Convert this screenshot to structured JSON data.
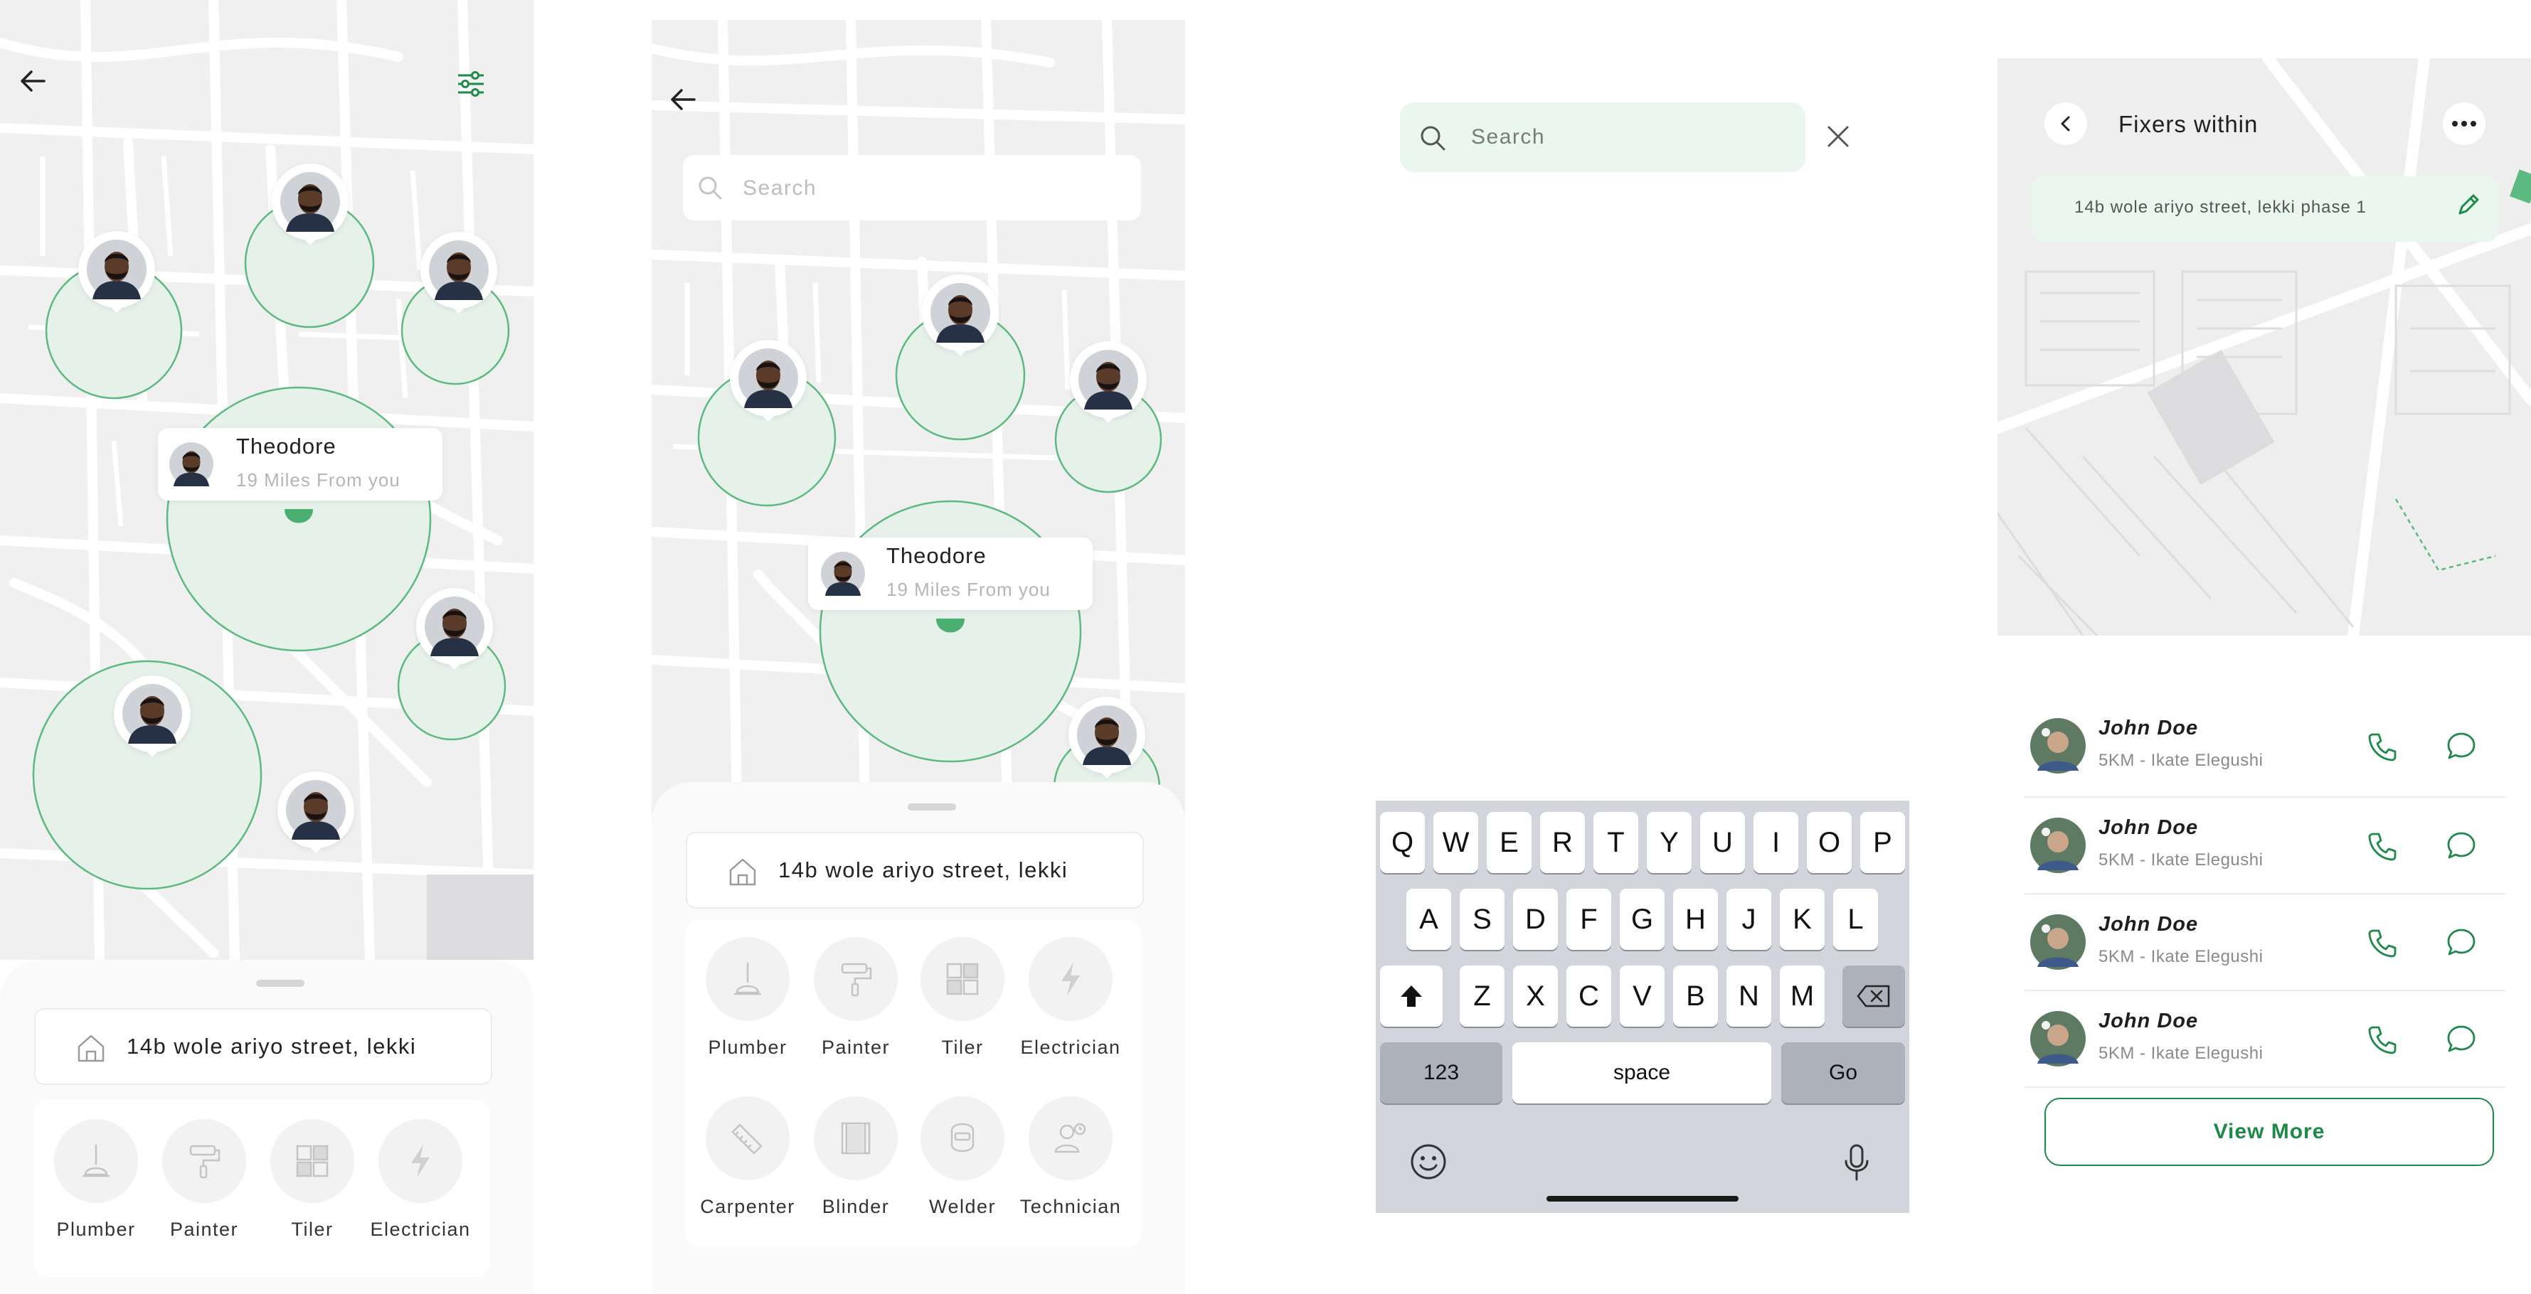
{
  "colors": {
    "accent": "#1e8a4a",
    "circle_fill": "#e6f1ea",
    "circle_stroke": "#5cb97f",
    "map_bg": "#f0f0f1",
    "road": "#ffffff",
    "search_bg": "#eaf7ef"
  },
  "screen1": {
    "back_icon": "arrow-left-icon",
    "filter_icon": "sliders-icon",
    "callout": {
      "name": "Theodore",
      "distance": "19 Miles From you"
    },
    "address": "14b wole ariyo street, lekki",
    "categories": [
      {
        "label": "Plumber",
        "icon": "plunger-icon"
      },
      {
        "label": "Painter",
        "icon": "paint-roller-icon"
      },
      {
        "label": "Tiler",
        "icon": "tiles-icon"
      },
      {
        "label": "Electrician",
        "icon": "lightning-icon"
      }
    ]
  },
  "screen2": {
    "back_icon": "arrow-left-icon",
    "search_placeholder": "Search",
    "callout": {
      "name": "Theodore",
      "distance": "19 Miles From you"
    },
    "address": "14b wole ariyo street, lekki",
    "categories": [
      {
        "label": "Plumber",
        "icon": "plunger-icon"
      },
      {
        "label": "Painter",
        "icon": "paint-roller-icon"
      },
      {
        "label": "Tiler",
        "icon": "tiles-icon"
      },
      {
        "label": "Electrician",
        "icon": "lightning-icon"
      },
      {
        "label": "Carpenter",
        "icon": "saw-icon"
      },
      {
        "label": "Blinder",
        "icon": "blinds-icon"
      },
      {
        "label": "Welder",
        "icon": "welding-mask-icon"
      },
      {
        "label": "Technician",
        "icon": "technician-icon"
      }
    ]
  },
  "screen3": {
    "search_placeholder": "Search",
    "close_icon": "close-icon",
    "keyboard": {
      "row1": [
        "Q",
        "W",
        "E",
        "R",
        "T",
        "Y",
        "U",
        "I",
        "O",
        "P"
      ],
      "row2": [
        "A",
        "S",
        "D",
        "F",
        "G",
        "H",
        "J",
        "K",
        "L"
      ],
      "row3": [
        "Z",
        "X",
        "C",
        "V",
        "B",
        "N",
        "M"
      ],
      "numbers_key": "123",
      "space_key": "space",
      "go_key": "Go",
      "shift_icon": "shift-icon",
      "backspace_icon": "backspace-icon",
      "emoji_icon": "emoji-icon",
      "mic_icon": "microphone-icon"
    }
  },
  "screen4": {
    "title": "Fixers within",
    "address": "14b wole ariyo street, lekki phase 1",
    "more_icon": "more-horizontal-icon",
    "edit_icon": "pencil-icon",
    "fixers": [
      {
        "name": "John Doe",
        "detail": "5KM - Ikate Elegushi"
      },
      {
        "name": "John Doe",
        "detail": "5KM - Ikate Elegushi"
      },
      {
        "name": "John Doe",
        "detail": "5KM - Ikate Elegushi"
      },
      {
        "name": "John Doe",
        "detail": "5KM - Ikate Elegushi"
      }
    ],
    "view_more": "View More"
  }
}
